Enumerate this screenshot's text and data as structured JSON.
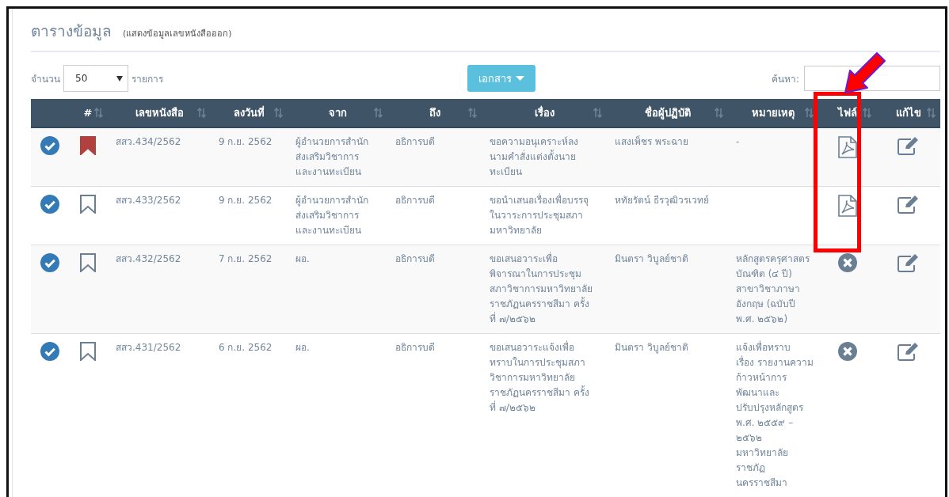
{
  "title": "ตารางข้อมูล",
  "subtitle": "(แสดงข้อมูลเลขหนังสือออก)",
  "length_control": {
    "label_before": "จำนวน",
    "value": "50",
    "label_after": "รายการ"
  },
  "documents_button": "เอกสาร",
  "search": {
    "label": "ค้นหา:"
  },
  "table": {
    "columns": [
      "",
      "#",
      "เลขหนังสือ",
      "ลงวันที่",
      "จาก",
      "ถึง",
      "เรื่อง",
      "ชื่อผู้ปฏิบัติ",
      "หมายเหตุ",
      "ไฟล์",
      "แก้ไข"
    ],
    "rows": [
      {
        "bookmarked": true,
        "number": "สสว.434/2562",
        "date": "9 ก.ย. 2562",
        "from": "ผู้อำนวยการสำนัก\nส่งเสริมวิชาการ\nและงานทะเบียน",
        "to": "อธิการบดี",
        "subject": "ขอความอนุเคราะห์ลง\nนามคำสั่งแต่งตั้งนาย\nทะเบียน",
        "assignee": "แสงเพ็ชร พระฉาย",
        "note": "-",
        "kind": "pdf"
      },
      {
        "bookmarked": false,
        "number": "สสว.433/2562",
        "date": "9 ก.ย. 2562",
        "from": "ผู้อำนวยการสำนัก\nส่งเสริมวิชาการ\nและงานทะเบียน",
        "to": "อธิการบดี",
        "subject": "ขอนำเสนอเรื่องเพื่อบรรจุ\nในวาระการประชุมสภา\nมหาวิทยาลัย",
        "assignee": "หทัยรัตน์ ธีรวุฒิวรเวทย์",
        "kind": "pdf"
      },
      {
        "bookmarked": false,
        "number": "สสว.432/2562",
        "date": "7 ก.ย. 2562",
        "from": "ผอ.",
        "to": "อธิการบดี",
        "subject": "ขอเสนอวาระเพื่อ\nพิจารณาในการประชุม\nสภาวิชาการมหาวิทยาลัย\nราชภัฏนครราชสีมา ครั้ง\nที่ ๗/๒๕๖๒",
        "assignee": "มินตรา วิบูลย์ชาติ",
        "note": "หลักสูตรครุศาสตร\nบัณฑิต (๔ ปี)\nสาขาวิชาภาษา\nอังกฤษ (ฉบับปี\nพ.ศ. ๒๕๖๒)",
        "kind": "none"
      },
      {
        "bookmarked": false,
        "number": "สสว.431/2562",
        "date": "6 ก.ย. 2562",
        "from": "ผอ.",
        "to": "อธิการบดี",
        "subject": "ขอเสนอวาระแจ้งเพื่อ\nทราบในการประชุมสภา\nวิชาการมหาวิทยาลัย\nราชภัฏนครราชสีมา ครั้ง\nที่ ๗/๒๕๖๒",
        "assignee": "มินตรา วิบูลย์ชาติ",
        "note": "แจ้งเพื่อทราบ\nเรื่อง รายงานความ\nก้าวหน้าการ\nพัฒนาและ\nปรับปรุงหลักสูตร\nพ.ศ. ๒๕๕๙ –\n๒๕๖๒\nมหาวิทยาลัย\nราชภัฏ\nนครราชสีมา",
        "kind": "none"
      }
    ]
  }
}
